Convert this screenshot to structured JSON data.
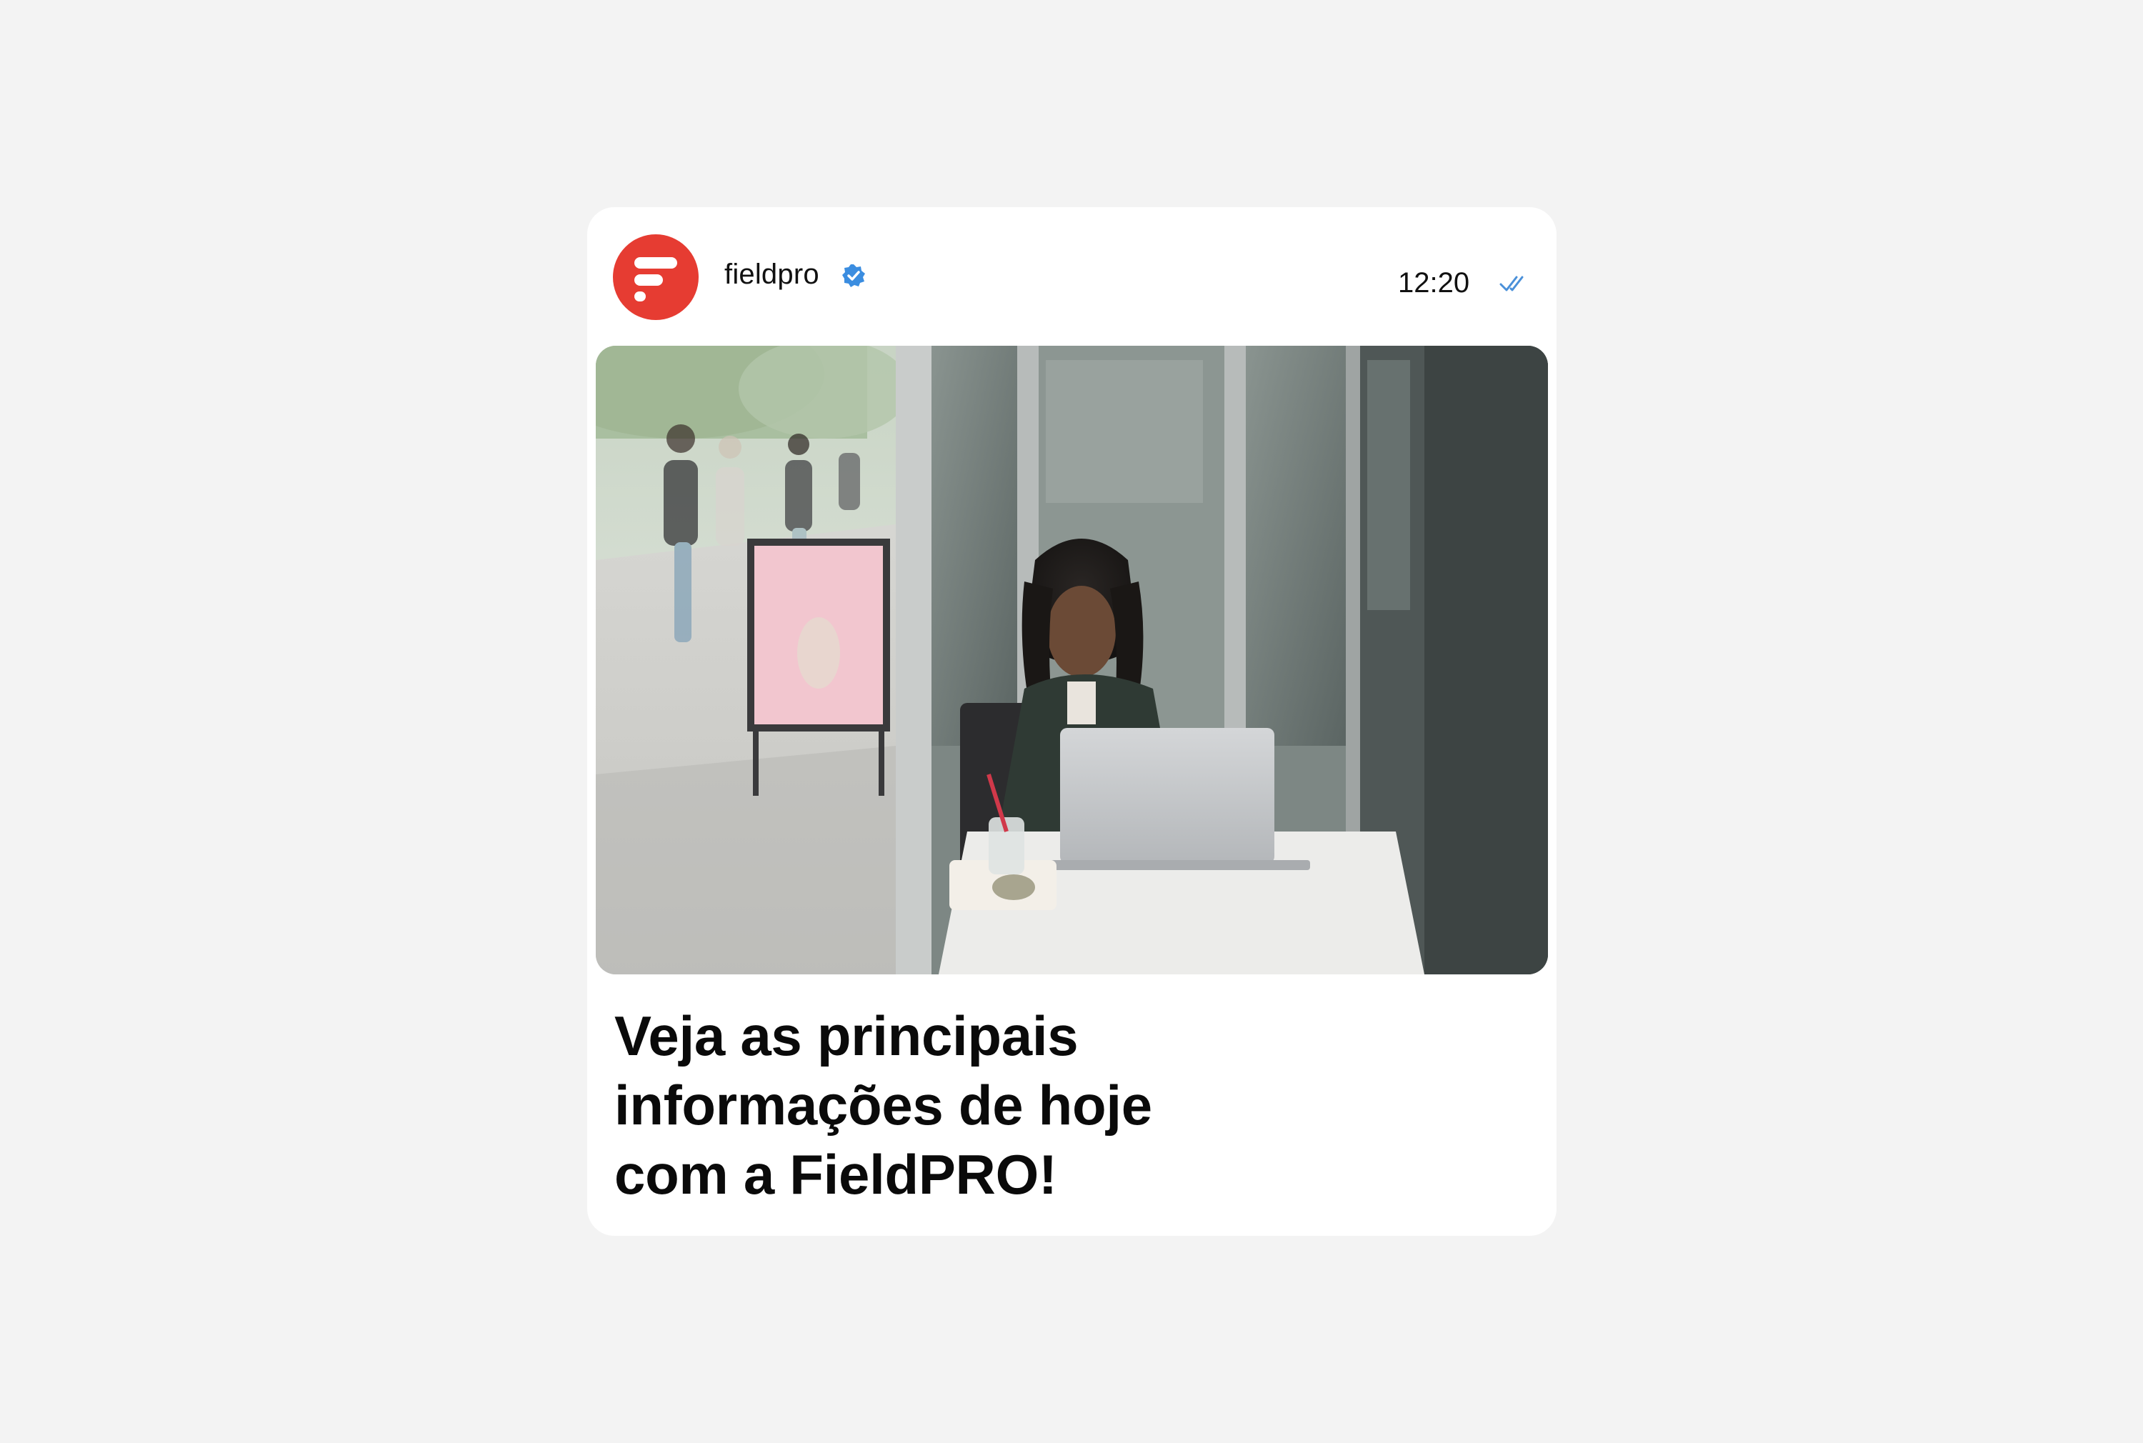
{
  "post": {
    "account_name": "fieldpro",
    "timestamp": "12:20",
    "headline": "Veja as principais\ninformações de hoje\ncom a FieldPRO!",
    "avatar_icon": "fieldpro-logo-icon",
    "verified_icon": "verified-badge-icon",
    "read_icon": "double-check-icon",
    "photo_subject": "photo"
  },
  "colors": {
    "brand": "#e63c32",
    "verified": "#3b8de0",
    "read_checks": "#4a90d9",
    "text": "#111111",
    "background": "#f3f3f3",
    "card": "#ffffff"
  }
}
